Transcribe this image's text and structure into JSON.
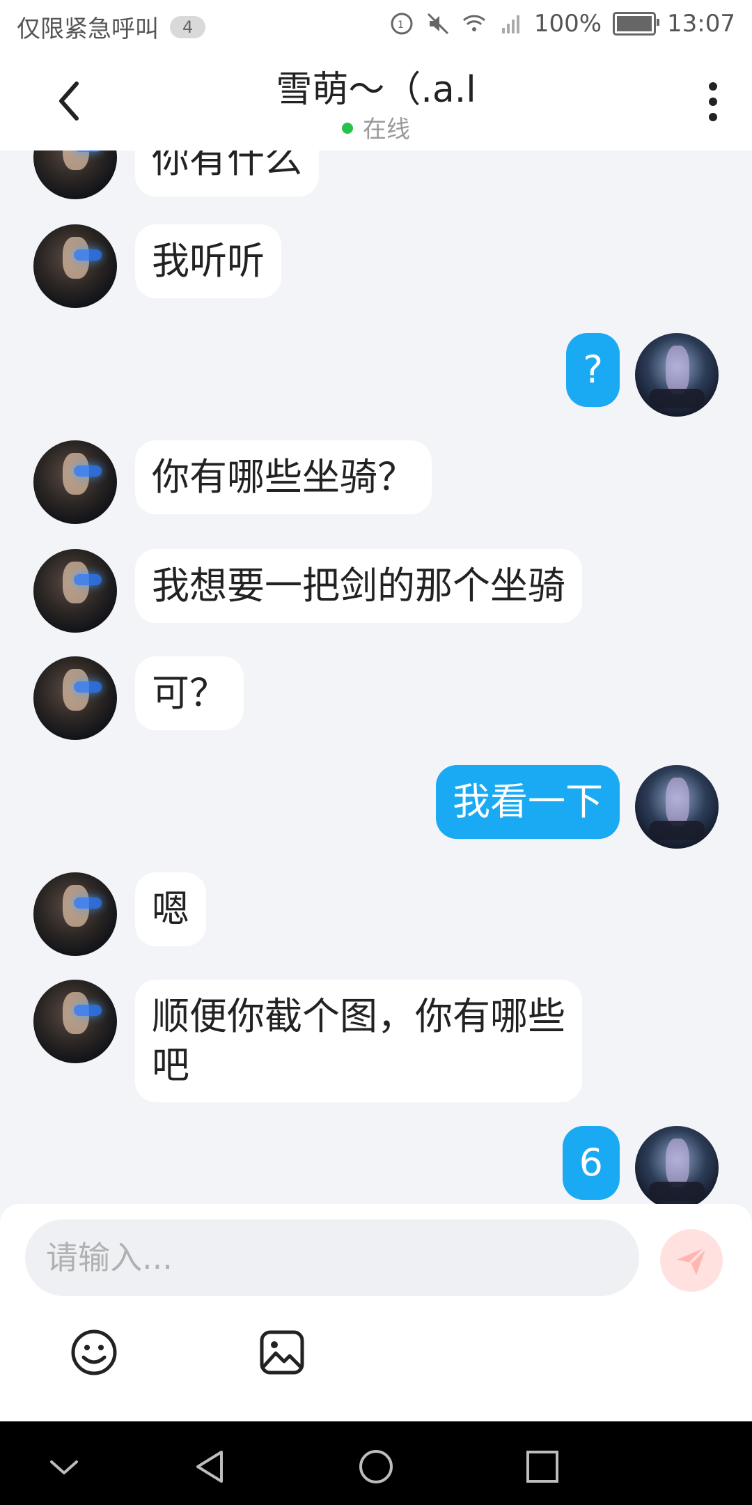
{
  "status_bar": {
    "carrier_text": "仅限紧急呼叫",
    "notification_count": "4",
    "battery": "100%",
    "time": "13:07"
  },
  "header": {
    "title": "雪萌～（.a.l",
    "status": "在线"
  },
  "messages": [
    {
      "side": "left",
      "text": "你有什么"
    },
    {
      "side": "left",
      "text": "我听听"
    },
    {
      "side": "right",
      "text": "?"
    },
    {
      "side": "left",
      "text": "你有哪些坐骑？"
    },
    {
      "side": "left",
      "text": "我想要一把剑的那个坐骑"
    },
    {
      "side": "left",
      "text": "可？"
    },
    {
      "side": "right",
      "text": "我看一下"
    },
    {
      "side": "left",
      "text": "嗯"
    },
    {
      "side": "left",
      "text": "顺便你截个图，你有哪些"
    },
    {
      "side": "left",
      "text": "吧"
    },
    {
      "side": "right",
      "text": "6"
    }
  ],
  "composer": {
    "placeholder": "请输入..."
  },
  "colors": {
    "accent": "#1aaaf4",
    "online": "#27c24c",
    "send_disabled": "#ffe1df"
  }
}
